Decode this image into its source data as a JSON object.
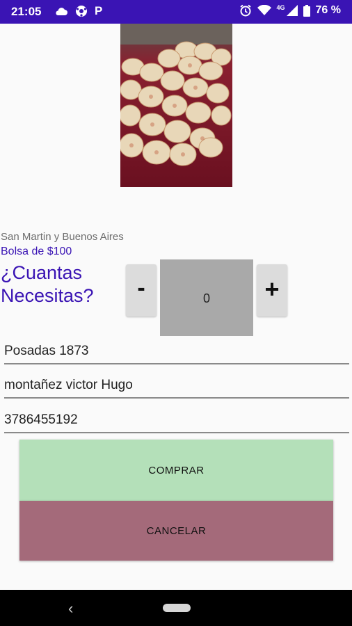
{
  "status_bar": {
    "time": "21:05",
    "app_letter": "P",
    "network": "4G",
    "battery": "76 %"
  },
  "product": {
    "location": "San Martin y Buenos Aires",
    "price_label": "Bolsa de $100",
    "question": "¿Cuantas Necesitas?"
  },
  "quantity": {
    "minus_label": "-",
    "value": "0",
    "plus_label": "+"
  },
  "form": {
    "address": "Posadas 1873",
    "name": "montañez victor Hugo",
    "phone": "3786455192"
  },
  "actions": {
    "buy_label": "COMPRAR",
    "cancel_label": "CANCELAR"
  },
  "navigation": {
    "back_icon": "‹"
  },
  "colors": {
    "accent": "#3a14b4",
    "buy_button": "#b4e0b9",
    "cancel_button": "#a46a7a"
  }
}
